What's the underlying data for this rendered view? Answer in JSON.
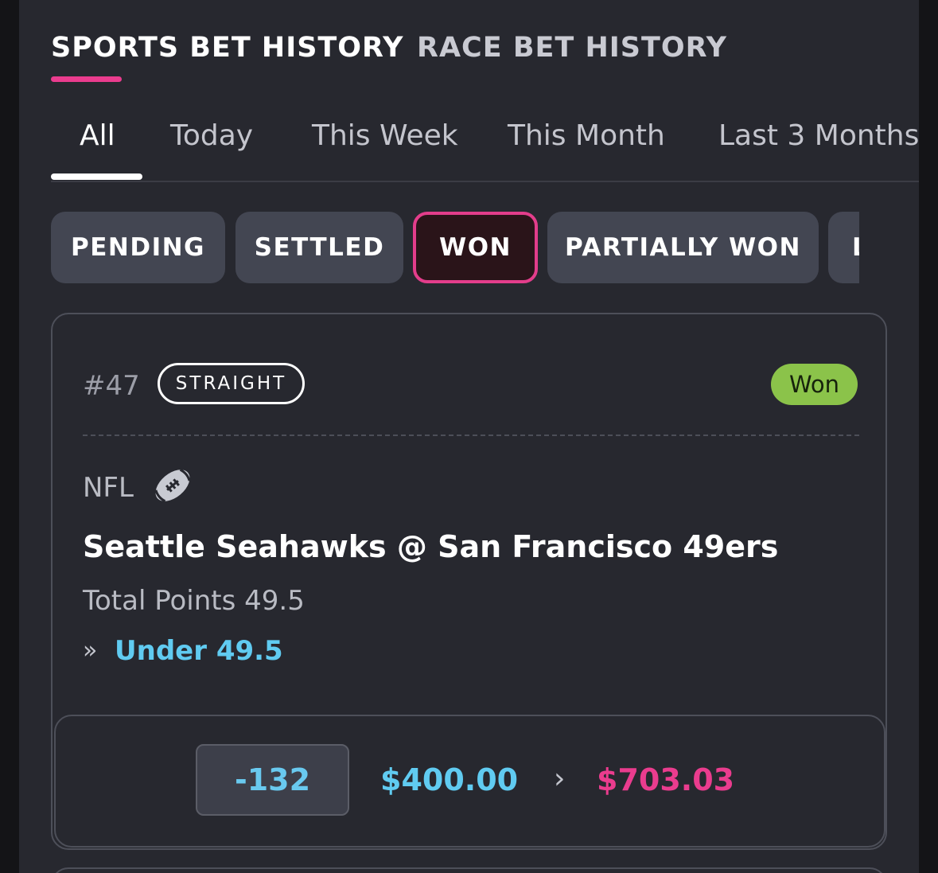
{
  "top_tabs": {
    "sports": "SPORTS BET HISTORY",
    "race": "RACE BET HISTORY"
  },
  "period_tabs": [
    "All",
    "Today",
    "This Week",
    "This Month",
    "Last 3 Months"
  ],
  "filters": [
    "PENDING",
    "SETTLED",
    "WON",
    "PARTIALLY WON",
    "L"
  ],
  "selected_filter": "WON",
  "bet": {
    "number": "#47",
    "type": "STRAIGHT",
    "status": "Won",
    "league": "NFL",
    "league_icon": "football-icon",
    "matchup": "Seattle Seahawks @ San Francisco 49ers",
    "market": "Total Points 49.5",
    "selection_arrow": "»",
    "selection": "Under 49.5",
    "odds": "-132",
    "stake": "$400.00",
    "payout_arrow": "›",
    "payout": "$703.03"
  },
  "colors": {
    "accent_pink": "#ea3c8e",
    "accent_blue": "#60cbf1",
    "won_green": "#8bc34a",
    "background": "#27282f"
  }
}
